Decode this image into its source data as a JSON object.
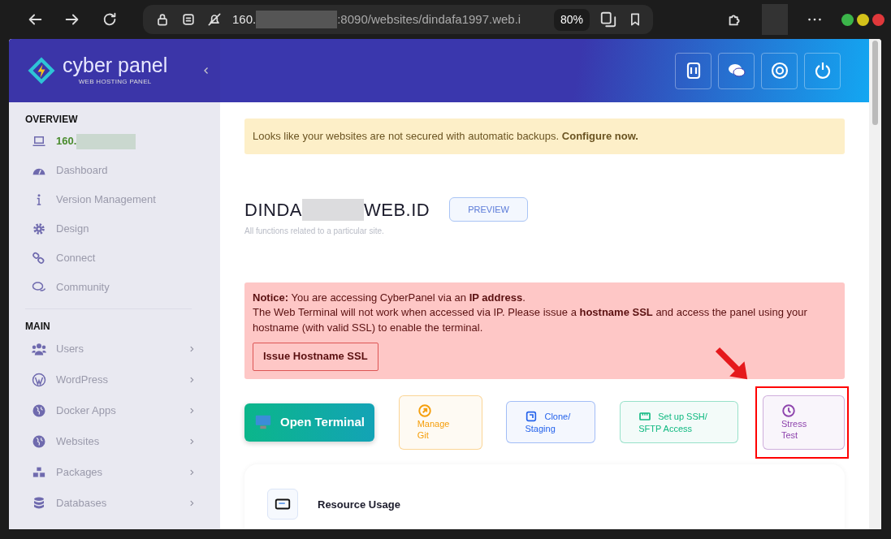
{
  "browser": {
    "url_start": "160.",
    "url_end": ":8090/websites/dindafa1997.web.i",
    "zoom": "80%"
  },
  "brand": {
    "name": "cyber panel",
    "tagline": "WEB HOSTING PANEL"
  },
  "sidebar": {
    "sections": [
      {
        "heading": "OVERVIEW",
        "items": [
          {
            "label": "160.",
            "kind": "host",
            "submenu": false
          },
          {
            "label": "Dashboard",
            "kind": "link",
            "submenu": false
          },
          {
            "label": "Version Management",
            "kind": "link",
            "submenu": false
          },
          {
            "label": "Design",
            "kind": "link",
            "submenu": false
          },
          {
            "label": "Connect",
            "kind": "link",
            "submenu": false
          },
          {
            "label": "Community",
            "kind": "link",
            "submenu": false
          }
        ]
      },
      {
        "heading": "MAIN",
        "items": [
          {
            "label": "Users",
            "kind": "link",
            "submenu": true
          },
          {
            "label": "WordPress",
            "kind": "link",
            "submenu": true
          },
          {
            "label": "Docker Apps",
            "kind": "link",
            "submenu": true
          },
          {
            "label": "Websites",
            "kind": "link",
            "submenu": true
          },
          {
            "label": "Packages",
            "kind": "link",
            "submenu": true
          },
          {
            "label": "Databases",
            "kind": "link",
            "submenu": true
          }
        ]
      }
    ]
  },
  "backup_alert": {
    "text": "Looks like your websites are not secured with automatic backups. **Configure now.**"
  },
  "site": {
    "name_start": "DINDA",
    "name_end": "WEB.ID",
    "preview": "PREVIEW",
    "subtitle": "All functions related to a particular site."
  },
  "notice": {
    "lines": [
      "**Notice:** You are accessing CyberPanel via an **IP address**.",
      "The Web Terminal will not work when accessed via IP. Please issue a **hostname SSL** and access the panel using your hostname (with valid SSL) to enable the terminal."
    ],
    "button": "Issue Hostname SSL"
  },
  "actions": [
    {
      "kind": "terminal",
      "lines": [
        "Open Terminal"
      ],
      "highlighted": false
    },
    {
      "kind": "stacked",
      "lines": [
        "Manage",
        "Git"
      ],
      "color": "#f59e0b",
      "highlighted": false
    },
    {
      "kind": "inline",
      "lines": [
        "Clone/",
        "Staging"
      ],
      "color": "#2563eb",
      "highlighted": false
    },
    {
      "kind": "inline",
      "lines": [
        "Set up SSH/",
        "SFTP Access"
      ],
      "color": "#10b981",
      "highlighted": false
    },
    {
      "kind": "stacked",
      "lines": [
        "Stress",
        "Test"
      ],
      "color": "#8e44ad",
      "highlighted": true
    }
  ],
  "resource_card": {
    "title": "Resource Usage"
  }
}
